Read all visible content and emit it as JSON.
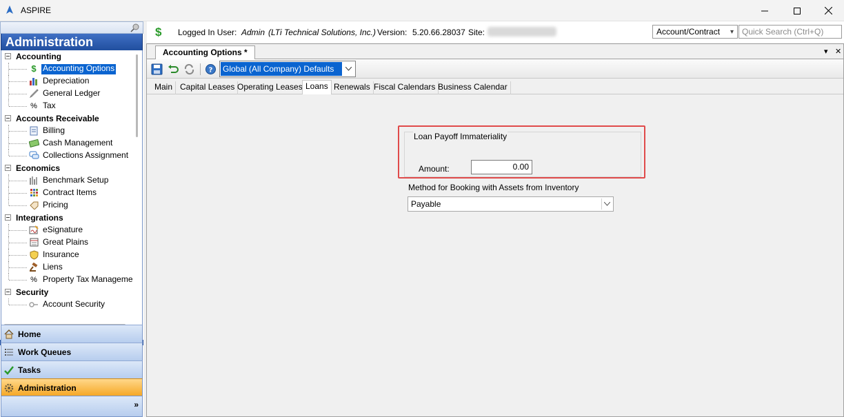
{
  "window": {
    "title": "ASPIRE"
  },
  "sidebar": {
    "header": "Administration",
    "groups": [
      {
        "label": "Accounting",
        "items": [
          {
            "label": "Accounting Options",
            "icon": "dollar-icon",
            "selected": true
          },
          {
            "label": "Depreciation",
            "icon": "bar-chart-icon"
          },
          {
            "label": "General Ledger",
            "icon": "quill-icon"
          },
          {
            "label": "Tax",
            "icon": "percent-icon",
            "glyph": "%"
          }
        ]
      },
      {
        "label": "Accounts Receivable",
        "items": [
          {
            "label": "Billing",
            "icon": "document-icon"
          },
          {
            "label": "Cash Management",
            "icon": "cash-icon"
          },
          {
            "label": "Collections Assignment",
            "icon": "chat-icon"
          }
        ]
      },
      {
        "label": "Economics",
        "items": [
          {
            "label": "Benchmark Setup",
            "icon": "benchmark-icon"
          },
          {
            "label": "Contract Items",
            "icon": "grid-icon"
          },
          {
            "label": "Pricing",
            "icon": "tag-icon"
          }
        ]
      },
      {
        "label": "Integrations",
        "items": [
          {
            "label": "eSignature",
            "icon": "signature-icon"
          },
          {
            "label": "Great Plains",
            "icon": "ledger-icon"
          },
          {
            "label": "Insurance",
            "icon": "shield-icon"
          },
          {
            "label": "Liens",
            "icon": "gavel-icon"
          },
          {
            "label": "Property Tax Manageme",
            "icon": "percent-icon",
            "glyph": "%"
          }
        ]
      },
      {
        "label": "Security",
        "items": [
          {
            "label": "Account Security",
            "icon": "key-icon"
          }
        ]
      }
    ],
    "nav": [
      {
        "label": "Home",
        "icon": "home-icon"
      },
      {
        "label": "Work Queues",
        "icon": "list-icon"
      },
      {
        "label": "Tasks",
        "icon": "check-icon"
      },
      {
        "label": "Administration",
        "icon": "gear-icon",
        "active": true
      }
    ],
    "footer_glyph": "»"
  },
  "infobar": {
    "dollar_glyph": "$",
    "logged_in_label": "Logged In User:",
    "logged_in_user": "Admin",
    "company": "(LTi Technical Solutions, Inc.)",
    "version_label": "Version:",
    "version": "5.20.66.28037",
    "site_label": "Site:",
    "search_scope": "Account/Contract",
    "search_placeholder": "Quick Search (Ctrl+Q)"
  },
  "document": {
    "tab_label": "Accounting Options *",
    "scope_value": "Global (All Company) Defaults",
    "subtabs": [
      "Main",
      "Capital Leases",
      "Operating Leases",
      "Loans",
      "Renewals",
      "Fiscal Calendars",
      "Business Calendar"
    ],
    "active_subtab": "Loans"
  },
  "loans": {
    "group_title": "Loan Payoff Immateriality",
    "amount_label": "Amount:",
    "amount_value": "0.00",
    "method_label": "Method for Booking with Assets from Inventory",
    "method_value": "Payable"
  },
  "colors": {
    "accent": "#0a64d0",
    "header_blue": "#2e5aa8",
    "active_nav": "#f5a623",
    "highlight": "#e04a4a"
  }
}
